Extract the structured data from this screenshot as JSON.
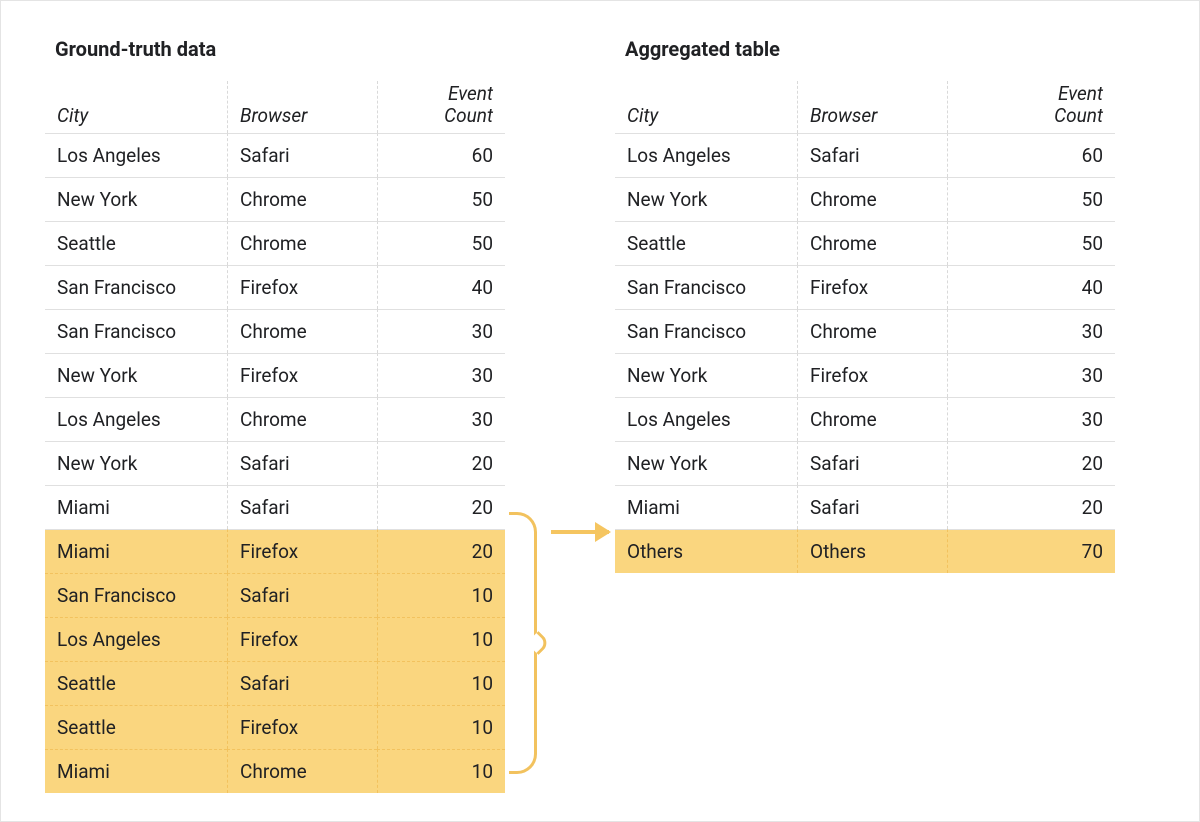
{
  "left": {
    "title": "Ground-truth data",
    "columns": {
      "city": "City",
      "browser": "Browser",
      "count": "Event\nCount"
    },
    "rows": [
      {
        "city": "Los Angeles",
        "browser": "Safari",
        "count": 60,
        "hl": false
      },
      {
        "city": "New York",
        "browser": "Chrome",
        "count": 50,
        "hl": false
      },
      {
        "city": "Seattle",
        "browser": "Chrome",
        "count": 50,
        "hl": false
      },
      {
        "city": "San Francisco",
        "browser": "Firefox",
        "count": 40,
        "hl": false
      },
      {
        "city": "San Francisco",
        "browser": "Chrome",
        "count": 30,
        "hl": false
      },
      {
        "city": "New York",
        "browser": "Firefox",
        "count": 30,
        "hl": false
      },
      {
        "city": "Los Angeles",
        "browser": "Chrome",
        "count": 30,
        "hl": false
      },
      {
        "city": "New York",
        "browser": "Safari",
        "count": 20,
        "hl": false
      },
      {
        "city": "Miami",
        "browser": "Safari",
        "count": 20,
        "hl": false
      },
      {
        "city": "Miami",
        "browser": "Firefox",
        "count": 20,
        "hl": true
      },
      {
        "city": "San Francisco",
        "browser": "Safari",
        "count": 10,
        "hl": true
      },
      {
        "city": "Los Angeles",
        "browser": "Firefox",
        "count": 10,
        "hl": true
      },
      {
        "city": "Seattle",
        "browser": "Safari",
        "count": 10,
        "hl": true
      },
      {
        "city": "Seattle",
        "browser": "Firefox",
        "count": 10,
        "hl": true
      },
      {
        "city": "Miami",
        "browser": "Chrome",
        "count": 10,
        "hl": true
      }
    ]
  },
  "right": {
    "title": "Aggregated table",
    "columns": {
      "city": "City",
      "browser": "Browser",
      "count": "Event\nCount"
    },
    "rows": [
      {
        "city": "Los Angeles",
        "browser": "Safari",
        "count": 60,
        "hl": false
      },
      {
        "city": "New York",
        "browser": "Chrome",
        "count": 50,
        "hl": false
      },
      {
        "city": "Seattle",
        "browser": "Chrome",
        "count": 50,
        "hl": false
      },
      {
        "city": "San Francisco",
        "browser": "Firefox",
        "count": 40,
        "hl": false
      },
      {
        "city": "San Francisco",
        "browser": "Chrome",
        "count": 30,
        "hl": false
      },
      {
        "city": "New York",
        "browser": "Firefox",
        "count": 30,
        "hl": false
      },
      {
        "city": "Los Angeles",
        "browser": "Chrome",
        "count": 30,
        "hl": false
      },
      {
        "city": "New York",
        "browser": "Safari",
        "count": 20,
        "hl": false
      },
      {
        "city": "Miami",
        "browser": "Safari",
        "count": 20,
        "hl": false
      },
      {
        "city": "Others",
        "browser": "Others",
        "count": 70,
        "hl": true
      }
    ]
  }
}
